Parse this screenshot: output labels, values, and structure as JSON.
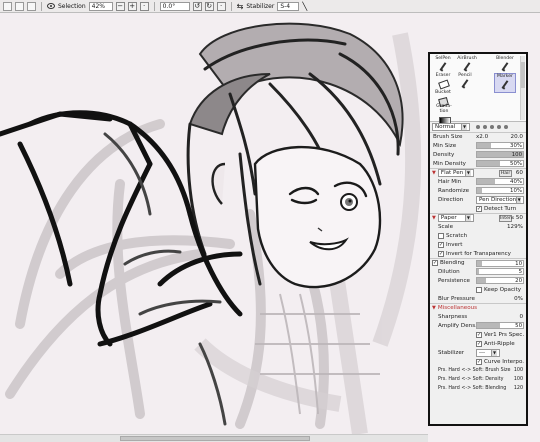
{
  "toolbar": {
    "selection_label": "Selection",
    "zoom": "42%",
    "rotation": "0.0°",
    "stabilizer_label": "Stabilizer",
    "stabilizer_value": "S-4"
  },
  "tools": [
    {
      "label": "SelPen",
      "icon": "selpen-icon",
      "selected": false
    },
    {
      "label": "AirBrush",
      "icon": "airbrush-icon",
      "selected": false
    },
    {
      "label": "Blender",
      "icon": "blender-icon",
      "selected": false
    },
    {
      "label": "Eraser",
      "icon": "eraser-icon",
      "selected": false
    },
    {
      "label": "Pencil",
      "icon": "pencil-icon",
      "selected": false
    },
    {
      "label": "Marker",
      "icon": "marker-icon",
      "selected": true
    },
    {
      "label": "Bucket",
      "icon": "bucket-icon",
      "selected": false
    },
    {
      "label": "Grada-tion",
      "icon": "gradation-icon",
      "selected": false
    }
  ],
  "panel": {
    "blend_mode": "Normal",
    "brush_size_label": "Brush Size",
    "brush_size_multiplier": "x2.0",
    "brush_size_value": "20.0",
    "min_size_label": "Min Size",
    "min_size_value": "30%",
    "density_label": "Density",
    "density_value": "100",
    "min_density_label": "Min Density",
    "min_density_value": "50%",
    "shape_name": "Flat Pen",
    "shape_button": "Hair",
    "shape_value": "60",
    "hair_min_label": "Hair Min",
    "hair_min_value": "40%",
    "randomize_label": "Randomize",
    "randomize_value": "10%",
    "direction_label": "Direction",
    "direction_value": "Pen Direction",
    "detect_turn_label": "Detect Turn",
    "texture_name": "Paper",
    "texture_button": "Intens",
    "texture_value": "50",
    "scale_label": "Scale",
    "scale_value": "129%",
    "scratch_label": "Scratch",
    "invert_label": "Invert",
    "invert_transparency_label": "Invert for Transparency",
    "blending_label": "Blending",
    "blending_value": "10",
    "dilution_label": "Dilution",
    "dilution_value": "5",
    "persistence_label": "Persistence",
    "persistence_value": "20",
    "keep_opacity_label": "Keep Opacity",
    "blur_pressure_label": "Blur Pressure",
    "blur_pressure_value": "0%",
    "misc_label": "Miscellaneous",
    "sharpness_label": "Sharpness",
    "sharpness_value": "0",
    "amplify_label": "Amplify Dens.",
    "amplify_value": "50",
    "ver1_label": "Ver1 Prs Spec.",
    "antiripple_label": "Anti-Ripple",
    "stabilizer_label": "Stabilizer",
    "stabilizer_value": "---",
    "curve_interpo_label": "Curve Interpo.",
    "prs_size_label": "Prs. Hard <-> Soft: Brush Size",
    "prs_size_value": "100",
    "prs_density_label": "Prs. Hard <-> Soft: Density",
    "prs_density_value": "100",
    "prs_blending_label": "Prs. Hard <-> Soft: Blending",
    "prs_blending_value": "120"
  },
  "progress": {
    "min_size": 0.3,
    "density": 1.0,
    "min_density": 0.5,
    "shape": 0.6,
    "hair_min": 0.4,
    "randomize": 0.1,
    "texture": 0.5,
    "blending": 0.1,
    "dilution": 0.05,
    "persistence": 0.2,
    "amplify": 0.5
  },
  "colors": {
    "panel_border": "#111111",
    "canvas_bg": "#f3eef1",
    "accent_section": "#b33333"
  }
}
